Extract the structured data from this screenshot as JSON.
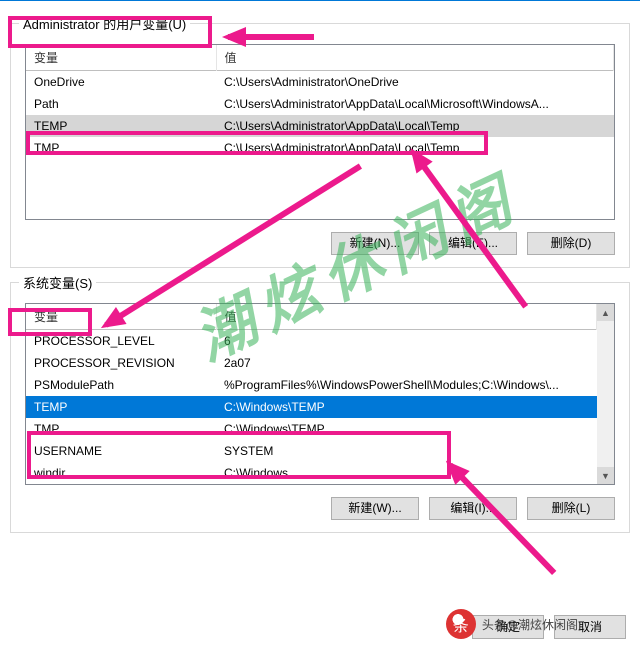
{
  "user_section": {
    "caption": "Administrator 的用户变量(U)",
    "col_var": "变量",
    "col_val": "值",
    "rows": [
      {
        "var": "OneDrive",
        "val": "C:\\Users\\Administrator\\OneDrive",
        "sel": ""
      },
      {
        "var": "Path",
        "val": "C:\\Users\\Administrator\\AppData\\Local\\Microsoft\\WindowsA...",
        "sel": ""
      },
      {
        "var": "TEMP",
        "val": "C:\\Users\\Administrator\\AppData\\Local\\Temp",
        "sel": "sel-grey"
      },
      {
        "var": "TMP",
        "val": "C:\\Users\\Administrator\\AppData\\Local\\Temp",
        "sel": ""
      }
    ],
    "buttons": {
      "new": "新建(N)...",
      "edit": "编辑(E)...",
      "del": "删除(D)"
    }
  },
  "sys_section": {
    "caption": "系统变量(S)",
    "col_var": "变量",
    "col_val": "值",
    "rows": [
      {
        "var": "PROCESSOR_LEVEL",
        "val": "6",
        "sel": ""
      },
      {
        "var": "PROCESSOR_REVISION",
        "val": "2a07",
        "sel": ""
      },
      {
        "var": "PSModulePath",
        "val": "%ProgramFiles%\\WindowsPowerShell\\Modules;C:\\Windows\\...",
        "sel": ""
      },
      {
        "var": "TEMP",
        "val": "C:\\Windows\\TEMP",
        "sel": "sel-blue"
      },
      {
        "var": "TMP",
        "val": "C:\\Windows\\TEMP",
        "sel": ""
      },
      {
        "var": "USERNAME",
        "val": "SYSTEM",
        "sel": ""
      },
      {
        "var": "windir",
        "val": "C:\\Windows",
        "sel": ""
      }
    ],
    "buttons": {
      "new": "新建(W)...",
      "edit": "编辑(I)...",
      "del": "删除(L)"
    }
  },
  "dialog_buttons": {
    "ok": "确定",
    "cancel": "取消"
  },
  "watermark": "潮炫休闲阁",
  "attribution": "头条@潮炫休闲阁"
}
